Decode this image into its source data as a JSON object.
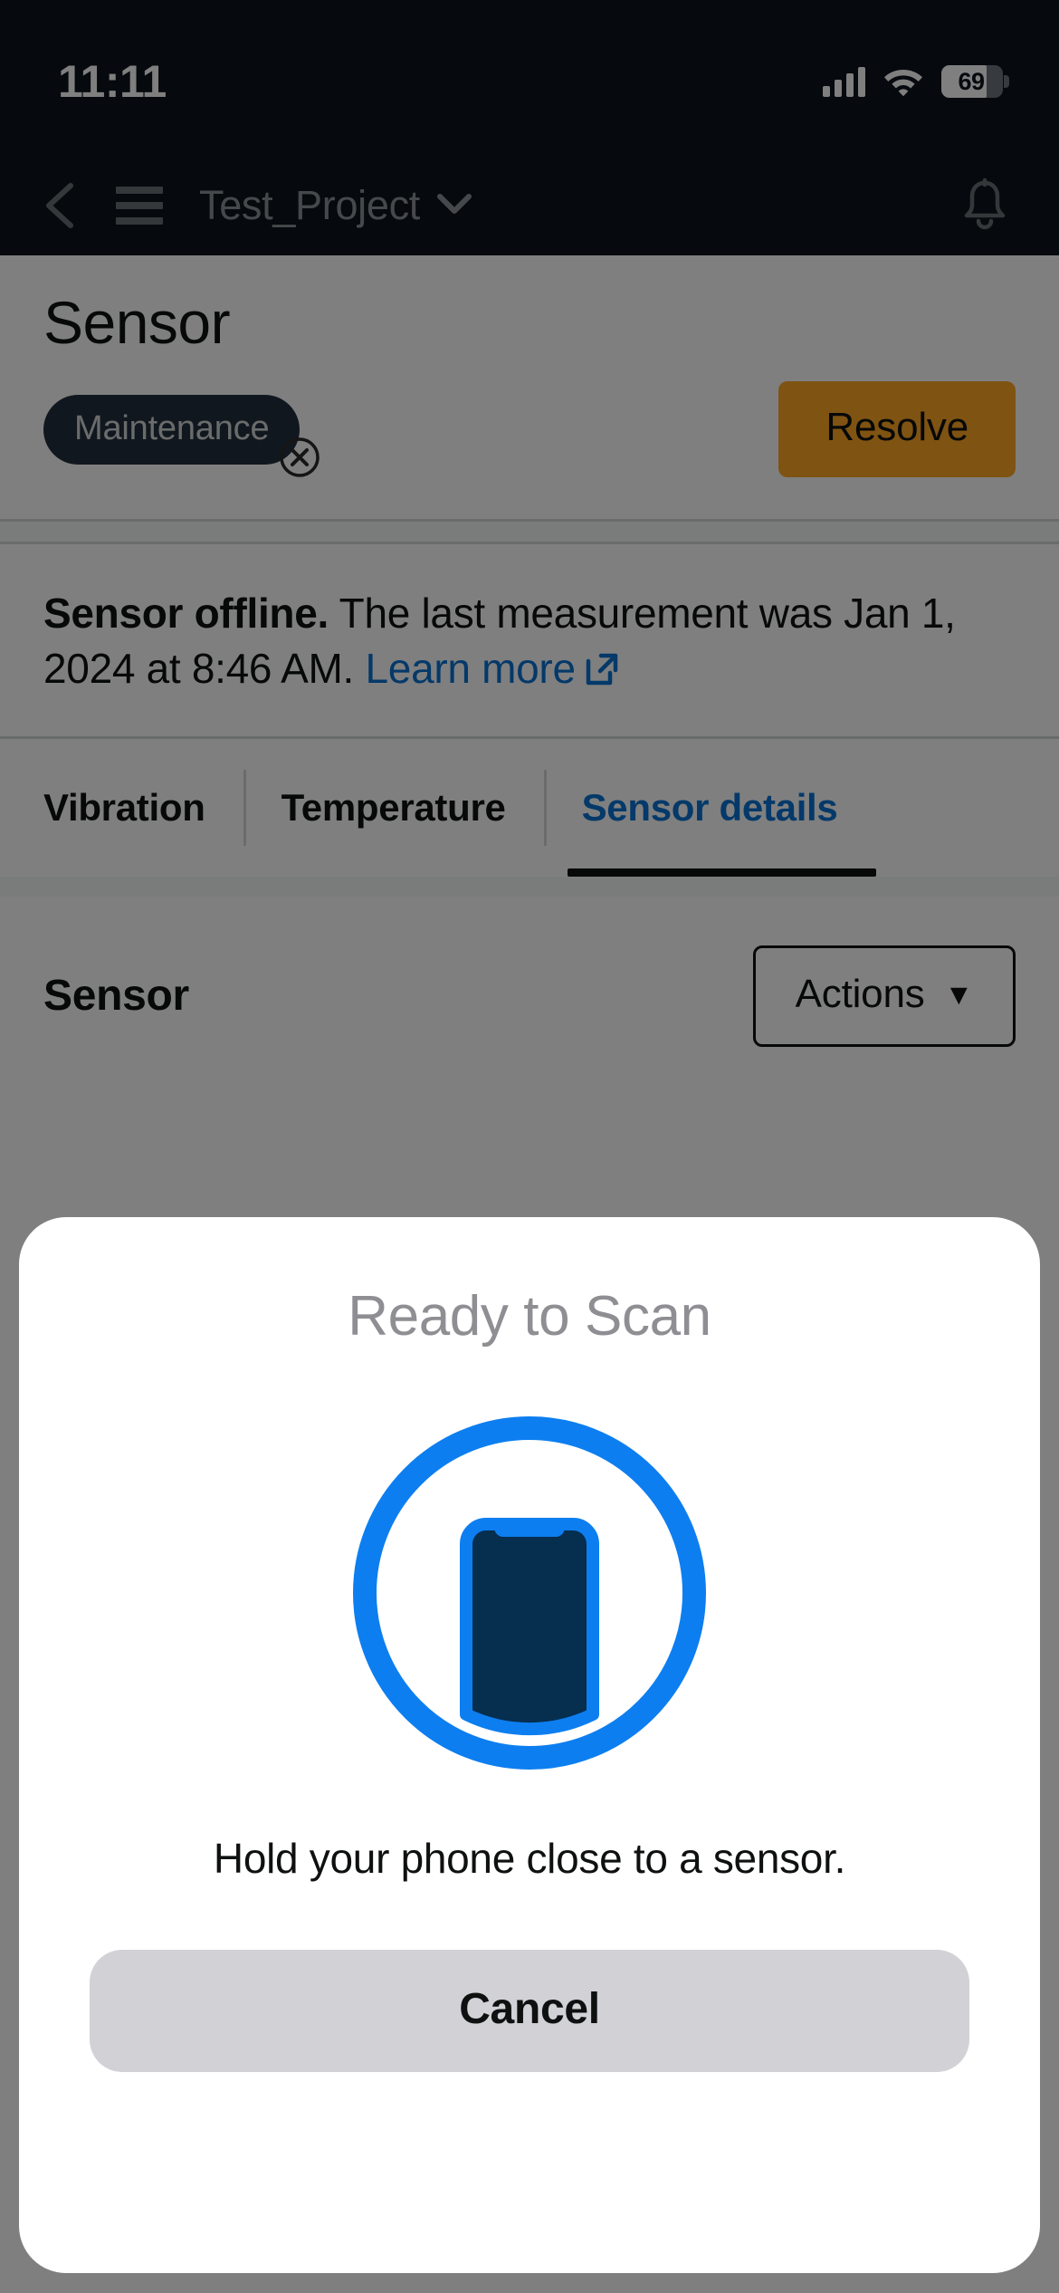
{
  "status_bar": {
    "time": "11:11",
    "battery_percent": "69",
    "signal_icon": "cellular-bars-icon",
    "wifi_icon": "wifi-icon",
    "battery_icon": "battery-icon"
  },
  "nav": {
    "back_icon": "chevron-left-icon",
    "menu_icon": "hamburger-menu-icon",
    "project_title": "Test_Project",
    "project_caret": "⌄",
    "notifications_icon": "bell-icon"
  },
  "page": {
    "title": "Sensor",
    "status_badge": "Maintenance",
    "badge_close_icon": "close-circle-icon",
    "resolve_label": "Resolve"
  },
  "alert": {
    "bold_text": "Sensor offline.",
    "body_text": " The last measurement was Jan 1, 2024 at 8:46 AM. ",
    "link_text": "Learn more",
    "external_icon": "external-link-icon"
  },
  "tabs": [
    {
      "label": "Vibration",
      "active": false
    },
    {
      "label": "Temperature",
      "active": false
    },
    {
      "label": "Sensor details",
      "active": true
    }
  ],
  "section": {
    "title": "Sensor",
    "actions_label": "Actions",
    "actions_caret": "▼"
  },
  "modal": {
    "title": "Ready to Scan",
    "icon": "nfc-phone-scan-icon",
    "subtitle": "Hold your phone close to a sensor.",
    "cancel_label": "Cancel"
  },
  "colors": {
    "nav_bg": "#0d121a",
    "accent_link": "#0972d3",
    "resolve_bg": "#ffa724",
    "badge_bg": "#232f3e",
    "scan_blue": "#0d7ef0",
    "scan_navy": "#052e4f",
    "cancel_bg": "#d1d1d6"
  }
}
